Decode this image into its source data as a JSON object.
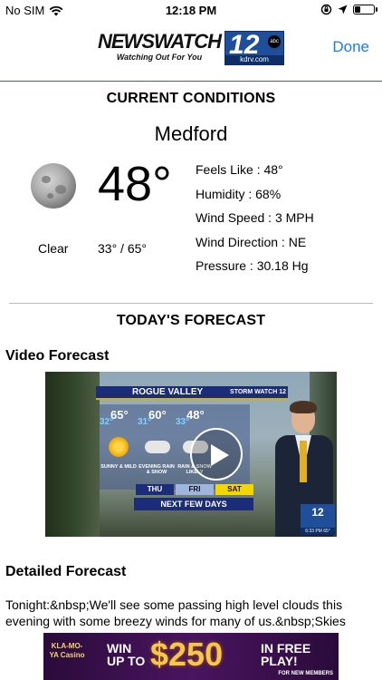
{
  "status_bar": {
    "carrier": "No SIM",
    "time": "12:18 PM"
  },
  "nav": {
    "logo_main": "NEWSWATCH",
    "logo_tagline": "Watching Out For You",
    "logo_number": "12",
    "logo_network": "abc",
    "logo_url": "kdrv.com",
    "done_label": "Done"
  },
  "current": {
    "title": "CURRENT CONDITIONS",
    "city": "Medford",
    "temp": "48°",
    "condition": "Clear",
    "hilo": "33° / 65°",
    "icon": "moon-icon",
    "details": [
      {
        "label": "Feels Like :",
        "value": "48°"
      },
      {
        "label": "Humidity :",
        "value": "68%"
      },
      {
        "label": "Wind Speed :",
        "value": "3 MPH"
      },
      {
        "label": "Wind Direction :",
        "value": "NE"
      },
      {
        "label": "Pressure :",
        "value": "30.18 Hg"
      }
    ]
  },
  "forecast": {
    "title": "TODAY'S FORECAST",
    "video_heading": "Video Forecast",
    "detailed_heading": "Detailed Forecast",
    "detailed_text": "Tonight:&nbsp;We'll see some passing high level clouds this evening with some breezy winds for many of us.&nbsp;Skies"
  },
  "video": {
    "region": "ROGUE VALLEY",
    "bug": "STORM WATCH 12",
    "days": [
      {
        "name": "THU",
        "hi": "65°",
        "lo": "32°",
        "desc": "SUNNY & MILD"
      },
      {
        "name": "FRI",
        "hi": "60°",
        "lo": "31°",
        "desc": "EVENING RAIN & SNOW"
      },
      {
        "name": "SAT",
        "hi": "48°",
        "lo": "33°",
        "desc": "RAIN & SNOW LIKELY"
      }
    ],
    "footer": "NEXT FEW DAYS",
    "station_number": "12",
    "station_time": "6:33 PM 65°"
  },
  "ad": {
    "brand": "KLA-MO-YA Casino",
    "win": "WIN UP TO",
    "amount": "$250",
    "free": "IN FREE PLAY!",
    "members": "FOR NEW MEMBERS"
  }
}
